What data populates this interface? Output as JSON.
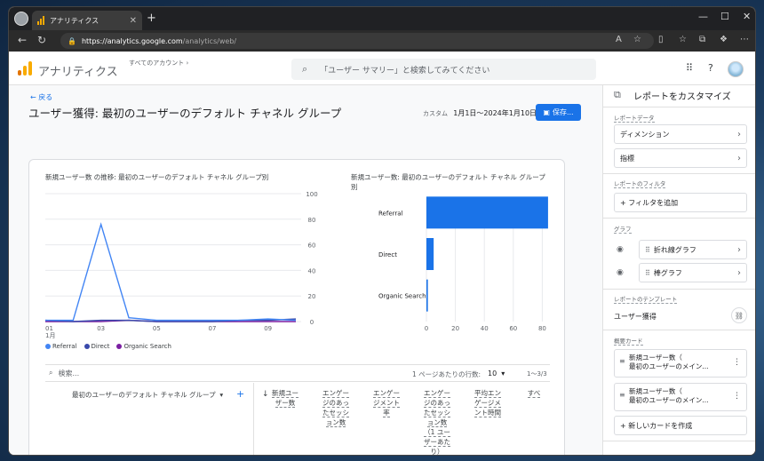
{
  "browser": {
    "tab_title": "アナリティクス",
    "url_host": "https://analytics.google.com",
    "url_path": "/analytics/web/"
  },
  "header": {
    "app_name": "アナリティクス",
    "account": "すべてのアカウント ›",
    "search_placeholder": "「ユーザー サマリー」と検索してみてください"
  },
  "main": {
    "back_label": "戻る",
    "title": "ユーザー獲得: 最初のユーザーのデフォルト チャネル グループ",
    "date_prefix": "カスタム",
    "date_range": "1月1日～2024年1月10日",
    "save_label": "保存..."
  },
  "chart_data": [
    {
      "type": "line",
      "title": "新規ユーザー数 の推移: 最初のユーザーのデフォルト チャネル グループ別",
      "x": [
        "01",
        "02",
        "03",
        "04",
        "05",
        "06",
        "07",
        "08",
        "09",
        "10"
      ],
      "x_tick_labels": [
        "01",
        "03",
        "05",
        "07",
        "09"
      ],
      "x_sub_label": "1月",
      "ylim": [
        0,
        100
      ],
      "y_ticks": [
        "0",
        "20",
        "40",
        "60",
        "80",
        "100"
      ],
      "series": [
        {
          "name": "Referral",
          "color": "#4285f4",
          "values": [
            1,
            1,
            76,
            3,
            1,
            1,
            1,
            1,
            2,
            1
          ]
        },
        {
          "name": "Direct",
          "color": "#3949ab",
          "values": [
            1,
            0,
            1,
            1,
            0,
            0,
            0,
            1,
            1,
            2
          ]
        },
        {
          "name": "Organic Search",
          "color": "#7b1fa2",
          "values": [
            0,
            0,
            0,
            1,
            0,
            0,
            0,
            0,
            0,
            0
          ]
        }
      ],
      "legend": "bottom-left"
    },
    {
      "type": "bar",
      "orientation": "horizontal",
      "title": "新規ユーザー数: 最初のユーザーのデフォルト チャネル グループ別",
      "categories": [
        "Referral",
        "Direct",
        "Organic Search"
      ],
      "values": [
        84,
        5,
        1
      ],
      "xlim": [
        0,
        100
      ],
      "x_ticks": [
        "0",
        "20",
        "40",
        "60",
        "80",
        "100"
      ],
      "color": "#1a73e8"
    }
  ],
  "table": {
    "search_placeholder": "検索...",
    "rows_per_page_label": "1 ページあたりの行数:",
    "rows_per_page_value": "10",
    "pagination": "1～3/3",
    "dimension_header": "最初のユーザーのデフォルト チャネル グループ",
    "metrics": [
      "新規ユーザー数",
      "エンゲージのあったセッション数",
      "エンゲージメント率",
      "エンゲージのあったセッション数（1 ユーザーあたり）",
      "平均エンゲージメント時間",
      "すべ"
    ]
  },
  "panel": {
    "title": "レポートをカスタマイズ",
    "report_data_label": "レポートデータ",
    "dimension": "ディメンション",
    "metric": "指標",
    "filter_label": "レポートのフィルタ",
    "add_filter": "+ フィルタを追加",
    "graph_label": "グラフ",
    "graph_line": "折れ線グラフ",
    "graph_bar": "棒グラフ",
    "template_label": "レポートのテンプレート",
    "template_value": "ユーザー獲得",
    "summary_label": "概要カード",
    "summary_cards": [
      {
        "line1": "新規ユーザー数（",
        "line2": "最初のユーザーのメイン..."
      },
      {
        "line1": "新規ユーザー数（",
        "line2": "最初のユーザーのメイン..."
      }
    ],
    "new_card": "+ 新しいカードを作成"
  }
}
